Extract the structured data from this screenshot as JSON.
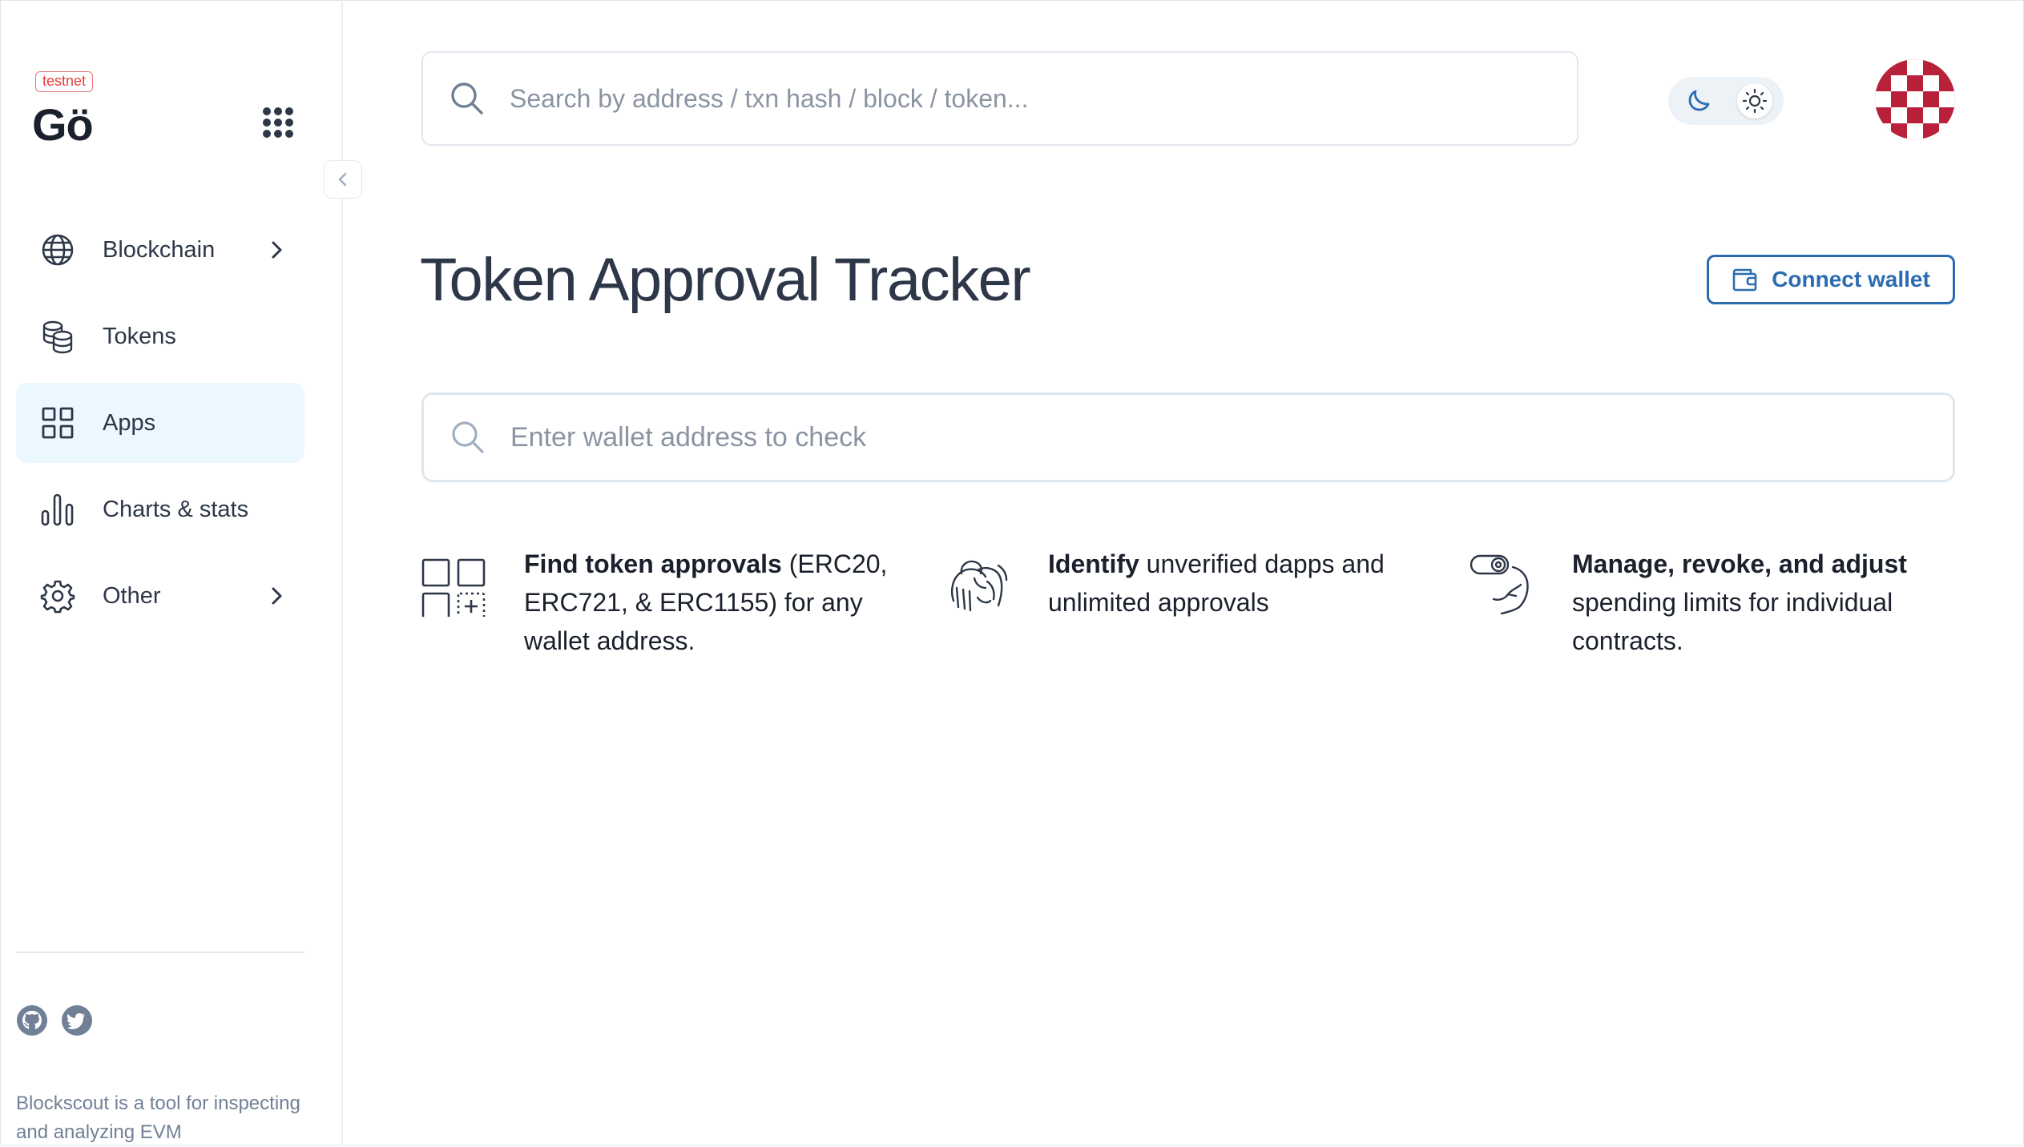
{
  "sidebar": {
    "network_badge": "testnet",
    "logo_text": "Gö",
    "items": [
      {
        "label": "Blockchain",
        "icon": "globe-icon",
        "has_chevron": true,
        "active": false
      },
      {
        "label": "Tokens",
        "icon": "coins-icon",
        "has_chevron": false,
        "active": false
      },
      {
        "label": "Apps",
        "icon": "apps-grid-icon",
        "has_chevron": false,
        "active": true
      },
      {
        "label": "Charts & stats",
        "icon": "bar-chart-icon",
        "has_chevron": false,
        "active": false
      },
      {
        "label": "Other",
        "icon": "gear-icon",
        "has_chevron": true,
        "active": false
      }
    ],
    "footer_text": "Blockscout is a tool for inspecting and analyzing EVM"
  },
  "header": {
    "search_placeholder": "Search by address / txn hash / block / token...",
    "theme": "light"
  },
  "main": {
    "title": "Token Approval Tracker",
    "connect_wallet_label": "Connect wallet",
    "wallet_search_placeholder": "Enter wallet address to check",
    "features": [
      {
        "bold": "Find token approvals",
        "rest": " (ERC20, ERC721, & ERC1155) for any wallet address."
      },
      {
        "bold": "Identify",
        "rest": " unverified dapps and unlimited approvals"
      },
      {
        "bold": "Manage, revoke, and adjust",
        "rest": " spending limits for individual contracts."
      }
    ]
  },
  "colors": {
    "accent": "#2b6cb0",
    "active_nav_bg": "#ebf8ff",
    "badge": "#e53e3e",
    "avatar": "#b7213a"
  }
}
